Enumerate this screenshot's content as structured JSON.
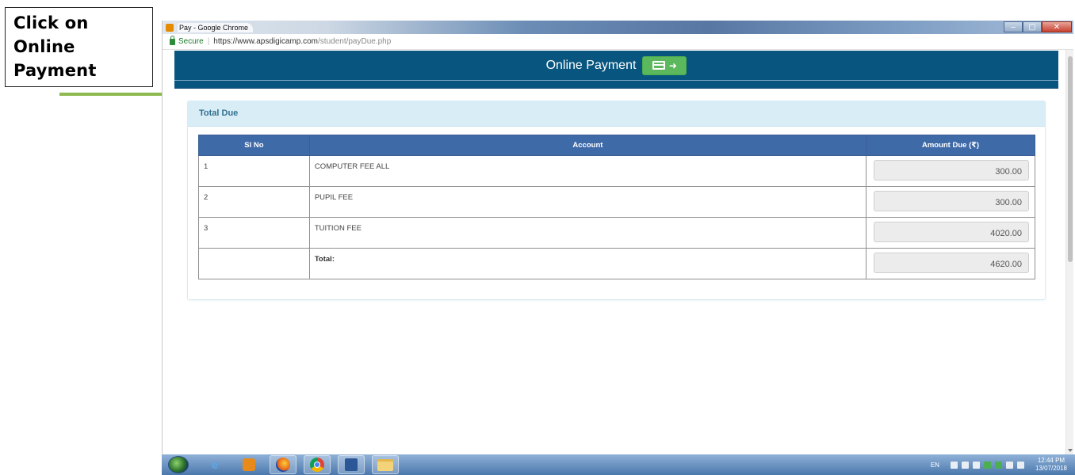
{
  "annotation": {
    "lines": [
      "Click on",
      "Online",
      "Payment"
    ]
  },
  "browser": {
    "tab_title": "Pay - Google Chrome",
    "secure_label": "Secure",
    "url_host": "https://www.apsdigicamp.com",
    "url_path": "/student/payDue.php",
    "window_controls": {
      "minimize": "–",
      "maximize": "▢",
      "close": "✕"
    }
  },
  "header": {
    "title": "Online Payment",
    "button_arrow": "➜"
  },
  "panel": {
    "heading": "Total Due"
  },
  "table": {
    "columns": [
      "Sl No",
      "Account",
      "Amount Due (₹)"
    ],
    "rows": [
      {
        "sl": "1",
        "account": "COMPUTER FEE ALL",
        "amount": "300.00"
      },
      {
        "sl": "2",
        "account": "PUPIL FEE",
        "amount": "300.00"
      },
      {
        "sl": "3",
        "account": "TUITION FEE",
        "amount": "4020.00"
      }
    ],
    "total_label": "Total:",
    "total_amount": "4620.00"
  },
  "taskbar": {
    "ie_glyph": "e",
    "language": "EN",
    "time": "12:44 PM",
    "date": "13/07/2018"
  },
  "colors": {
    "header_bg": "#08567f",
    "pay_button": "#5cb85c",
    "table_header": "#3f6aa8",
    "panel_heading_bg": "#d9edf7",
    "annotation_arrow": "#8db94f"
  },
  "icons": [
    "lock-icon",
    "card-icon",
    "arrow-right-icon",
    "start-orb-icon",
    "ie-icon",
    "media-player-icon",
    "firefox-icon",
    "chrome-icon",
    "word-icon",
    "folder-icon"
  ]
}
